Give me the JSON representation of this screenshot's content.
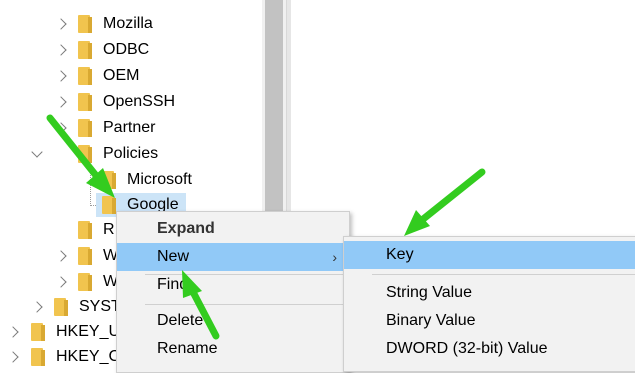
{
  "tree": {
    "items": [
      {
        "label": "Mozilla"
      },
      {
        "label": "ODBC"
      },
      {
        "label": "OEM"
      },
      {
        "label": "OpenSSH"
      },
      {
        "label": "Partner"
      },
      {
        "label": "Policies"
      },
      {
        "label": "Microsoft"
      },
      {
        "label": "Google"
      },
      {
        "label": "R"
      },
      {
        "label": "W"
      },
      {
        "label": "W"
      },
      {
        "label": "SYST"
      },
      {
        "label": "HKEY_U"
      },
      {
        "label": "HKEY_C"
      }
    ]
  },
  "context_menu": {
    "expand": "Expand",
    "new": "New",
    "find": "Find",
    "delete": "Delete",
    "rename": "Rename"
  },
  "submenu": {
    "key": "Key",
    "string_value": "String Value",
    "binary_value": "Binary Value",
    "dword_value": "DWORD (32-bit) Value"
  },
  "colors": {
    "highlight": "#91c9f7",
    "selection": "#cce4f7",
    "arrow": "#33cc1f",
    "folder": "#f1c44e"
  }
}
